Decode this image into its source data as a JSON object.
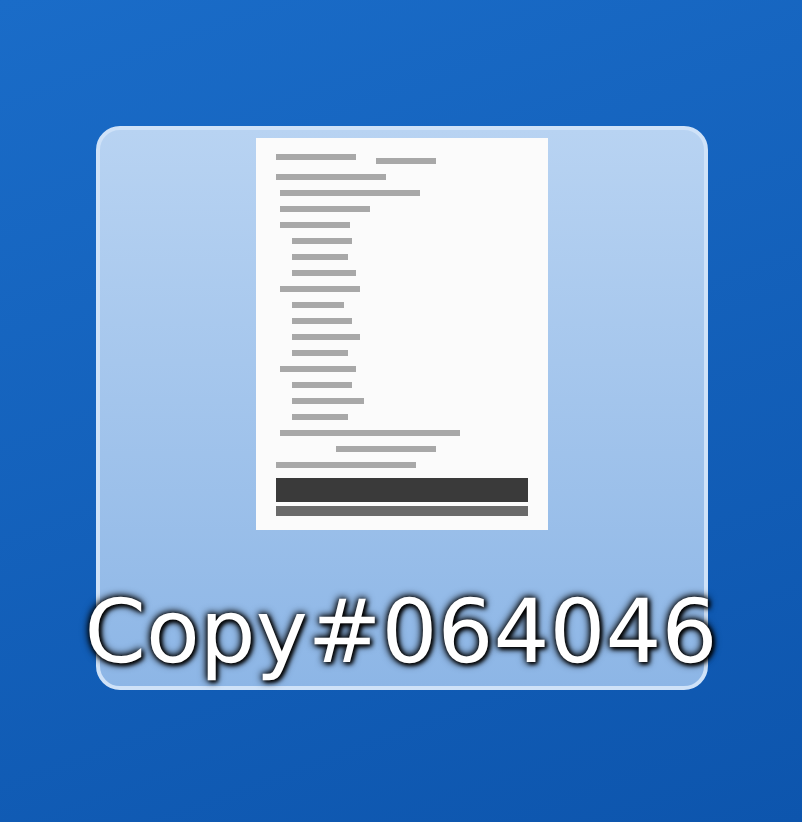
{
  "desktop_icon": {
    "label": "Copy#064046",
    "selected": true
  }
}
